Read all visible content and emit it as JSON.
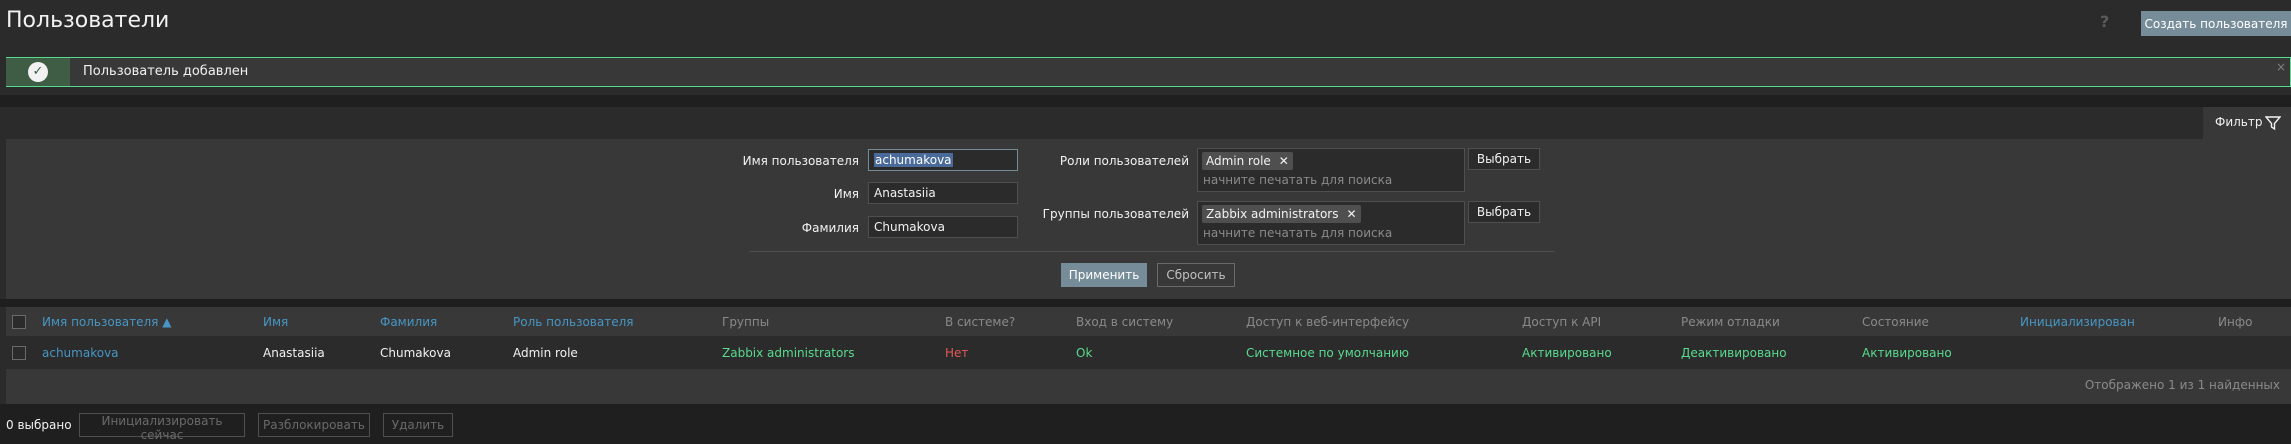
{
  "header": {
    "title": "Пользователи",
    "help_icon": "question-mark-icon",
    "create_button": "Создать пользователя"
  },
  "message": {
    "text": "Пользователь добавлен",
    "icon": "check-circle-icon",
    "close": "×"
  },
  "filter": {
    "tab_label": "Фильтр",
    "tab_icon": "funnel-icon",
    "username_label": "Имя пользователя",
    "username_value": "achumakova",
    "name_label": "Имя",
    "name_value": "Anastasiia",
    "surname_label": "Фамилия",
    "surname_value": "Chumakova",
    "roles_label": "Роли пользователей",
    "roles_chip": "Admin role",
    "roles_placeholder": "начните печатать для поиска",
    "groups_label": "Группы пользователей",
    "groups_chip": "Zabbix administrators",
    "groups_placeholder": "начните печатать для поиска",
    "select_button": "Выбрать",
    "apply_button": "Применить",
    "reset_button": "Сбросить"
  },
  "table": {
    "columns": [
      "Имя пользователя ▲",
      "Имя",
      "Фамилия",
      "Роль пользователя",
      "Группы",
      "В системе?",
      "Вход в систему",
      "Доступ к веб-интерфейсу",
      "Доступ к API",
      "Режим отладки",
      "Состояние",
      "Инициализирован",
      "Инфо"
    ],
    "row": {
      "username": "achumakova",
      "name": "Anastasiia",
      "surname": "Chumakova",
      "role": "Admin role",
      "groups": "Zabbix administrators",
      "online": "Нет",
      "login": "Ok",
      "frontend_access": "Системное по умолчанию",
      "api_access": "Активировано",
      "debug_mode": "Деактивировано",
      "status": "Активировано",
      "provisioned": "",
      "info": ""
    },
    "footer": "Отображено 1 из 1 найденных"
  },
  "actions": {
    "selected_count": "0 выбрано",
    "provision_button": "Инициализировать сейчас",
    "unblock_button": "Разблокировать",
    "delete_button": "Удалить"
  },
  "colors": {
    "accent_button": "#768d99",
    "link": "#4796c4",
    "success": "#59db8f",
    "error": "#e45959"
  }
}
